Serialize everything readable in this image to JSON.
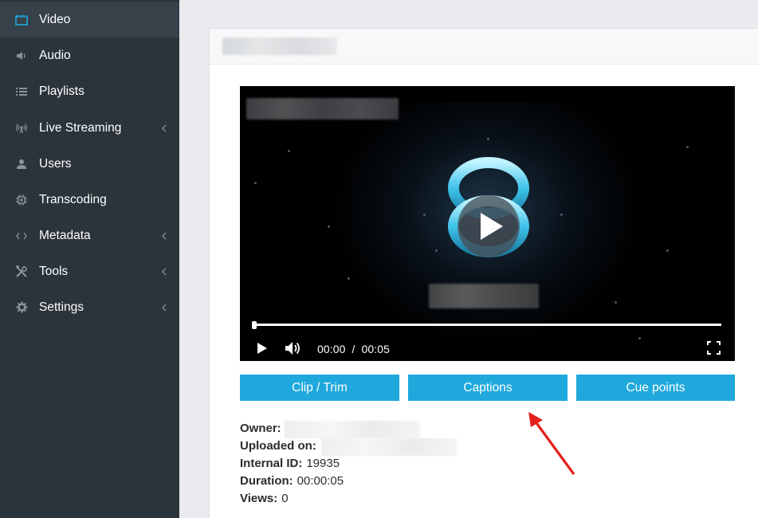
{
  "sidebar": {
    "items": [
      {
        "label": "Video",
        "icon": "clapperboard-icon",
        "active": true,
        "has_submenu": false
      },
      {
        "label": "Audio",
        "icon": "speaker-icon",
        "active": false,
        "has_submenu": false
      },
      {
        "label": "Playlists",
        "icon": "list-icon",
        "active": false,
        "has_submenu": false
      },
      {
        "label": "Live Streaming",
        "icon": "broadcast-icon",
        "active": false,
        "has_submenu": true
      },
      {
        "label": "Users",
        "icon": "user-icon",
        "active": false,
        "has_submenu": false
      },
      {
        "label": "Transcoding",
        "icon": "chip-icon",
        "active": false,
        "has_submenu": false
      },
      {
        "label": "Metadata",
        "icon": "code-icon",
        "active": false,
        "has_submenu": true
      },
      {
        "label": "Tools",
        "icon": "tools-icon",
        "active": false,
        "has_submenu": true
      },
      {
        "label": "Settings",
        "icon": "gear-icon",
        "active": false,
        "has_submenu": true
      }
    ]
  },
  "player": {
    "current_time": "00:00",
    "separator": "/",
    "duration": "00:05",
    "progress": 0
  },
  "actions": {
    "clip_label": "Clip / Trim",
    "captions_label": "Captions",
    "cue_points_label": "Cue points"
  },
  "info": {
    "owner_label": "Owner:",
    "uploaded_label": "Uploaded on:",
    "internal_id_label": "Internal ID:",
    "internal_id_value": "19935",
    "duration_label": "Duration:",
    "duration_value": "00:00:05",
    "views_label": "Views:",
    "views_value": "0"
  },
  "colors": {
    "sidebar_bg": "#2b343b",
    "sidebar_active": "#36414a",
    "accent": "#1fa8dc",
    "annotation_arrow": "#e3201b"
  }
}
